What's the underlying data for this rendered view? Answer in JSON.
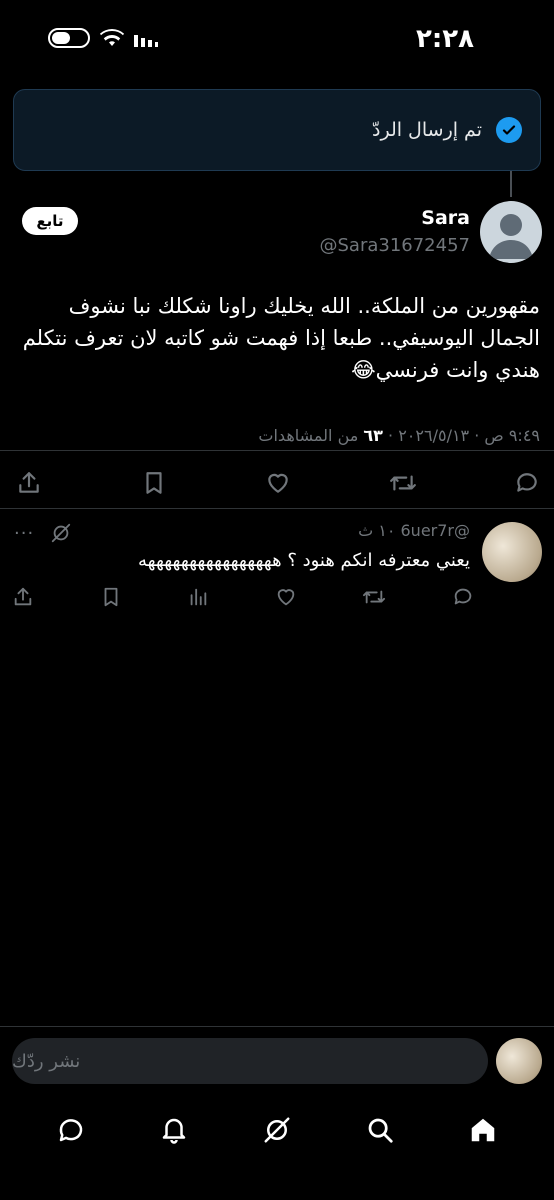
{
  "status_bar": {
    "time": "٢:٢٨"
  },
  "toast": {
    "message": "تم إرسال الردّ"
  },
  "tweet": {
    "author_name": "Sara",
    "author_handle": "@Sara31672457",
    "follow_label": "تابع",
    "text_line1": "مقهورين من الملكة.. الله يخليك راونا شكلك نبا نشوف",
    "text_line2": "الجمال اليوسيفي.. طبعا إذا فهمت شو كاتبه لان تعرف نتكلم",
    "text_line3": "هندي وانت فرنسي😂",
    "timestamp": "٩:٤٩ ص · ٢٠٢٦/٥/١٣ · ",
    "views_count": "٦٣",
    "views_label": " من المشاهدات"
  },
  "reply": {
    "handle": "@6uer7r",
    "time": "١٠ ث",
    "text": "يعني معترفه انكم هنود ؟ ههههههههههههههههه",
    "more_label": "···"
  },
  "compose": {
    "placeholder": "نشر ردّك"
  },
  "icons": {
    "actions": [
      "share-icon",
      "bookmark-icon",
      "like-icon",
      "retweet-icon",
      "reply-icon"
    ],
    "nav": [
      "home-icon",
      "search-icon",
      "grok-icon",
      "notifications-icon",
      "messages-icon"
    ]
  },
  "colors": {
    "accent": "#1d9bf0",
    "background": "#000000",
    "muted": "#71767b",
    "toast_bg": "#0c1a26"
  }
}
